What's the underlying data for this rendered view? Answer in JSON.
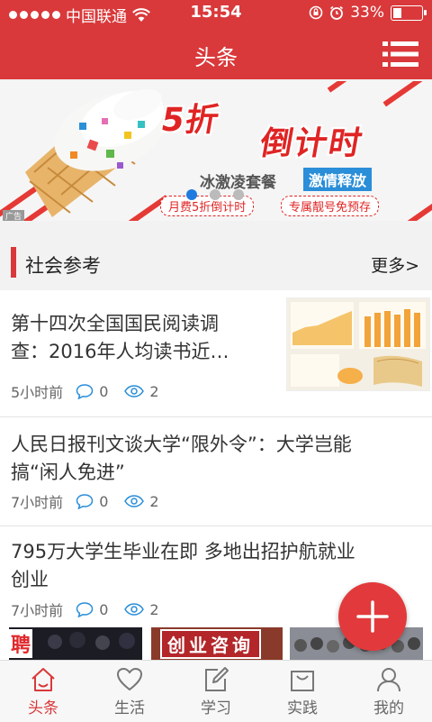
{
  "status_bar": {
    "carrier": "中国联通",
    "time": "15:54",
    "battery": "33%",
    "battery_level": 0.33
  },
  "header": {
    "title": "头条"
  },
  "banner": {
    "headline_1": "5折",
    "headline_2": "倒计时",
    "subtitle": "冰激凌套餐",
    "tag": "激情释放",
    "pill_1": "月费5折倒计时",
    "pill_2": "专属靓号免预存",
    "ad_label": "广告",
    "page_count": 3,
    "active_page": 0
  },
  "section": {
    "title": "社会参考",
    "more": "更多>"
  },
  "news": [
    {
      "title_line1": "第十四次全国国民阅读调",
      "title_line2": "查：2016年人均读书近…",
      "time": "5小时前",
      "comments": "0",
      "views": "2"
    },
    {
      "title_line1": "人民日报刊文谈大学“限外令”：大学岂能",
      "title_line2": "搞“闲人免进”",
      "time": "7小时前",
      "comments": "0",
      "views": "2"
    },
    {
      "title_line1": "795万大学生毕业在即 多地出招护航就业",
      "title_line2": "创业",
      "time": "7小时前",
      "comments": "0",
      "views": "2"
    }
  ],
  "strip": {
    "img2_text": "创业咨询",
    "img1_text": "聘"
  },
  "tabs": [
    {
      "label": "头条",
      "icon": "home-icon",
      "active": true
    },
    {
      "label": "生活",
      "icon": "heart-icon",
      "active": false
    },
    {
      "label": "学习",
      "icon": "edit-icon",
      "active": false
    },
    {
      "label": "实践",
      "icon": "bag-icon",
      "active": false
    },
    {
      "label": "我的",
      "icon": "user-icon",
      "active": false
    }
  ],
  "colors": {
    "brand_red": "#d9393b",
    "active_dot": "#1e7be0",
    "icon_blue": "#2a8ed8"
  }
}
